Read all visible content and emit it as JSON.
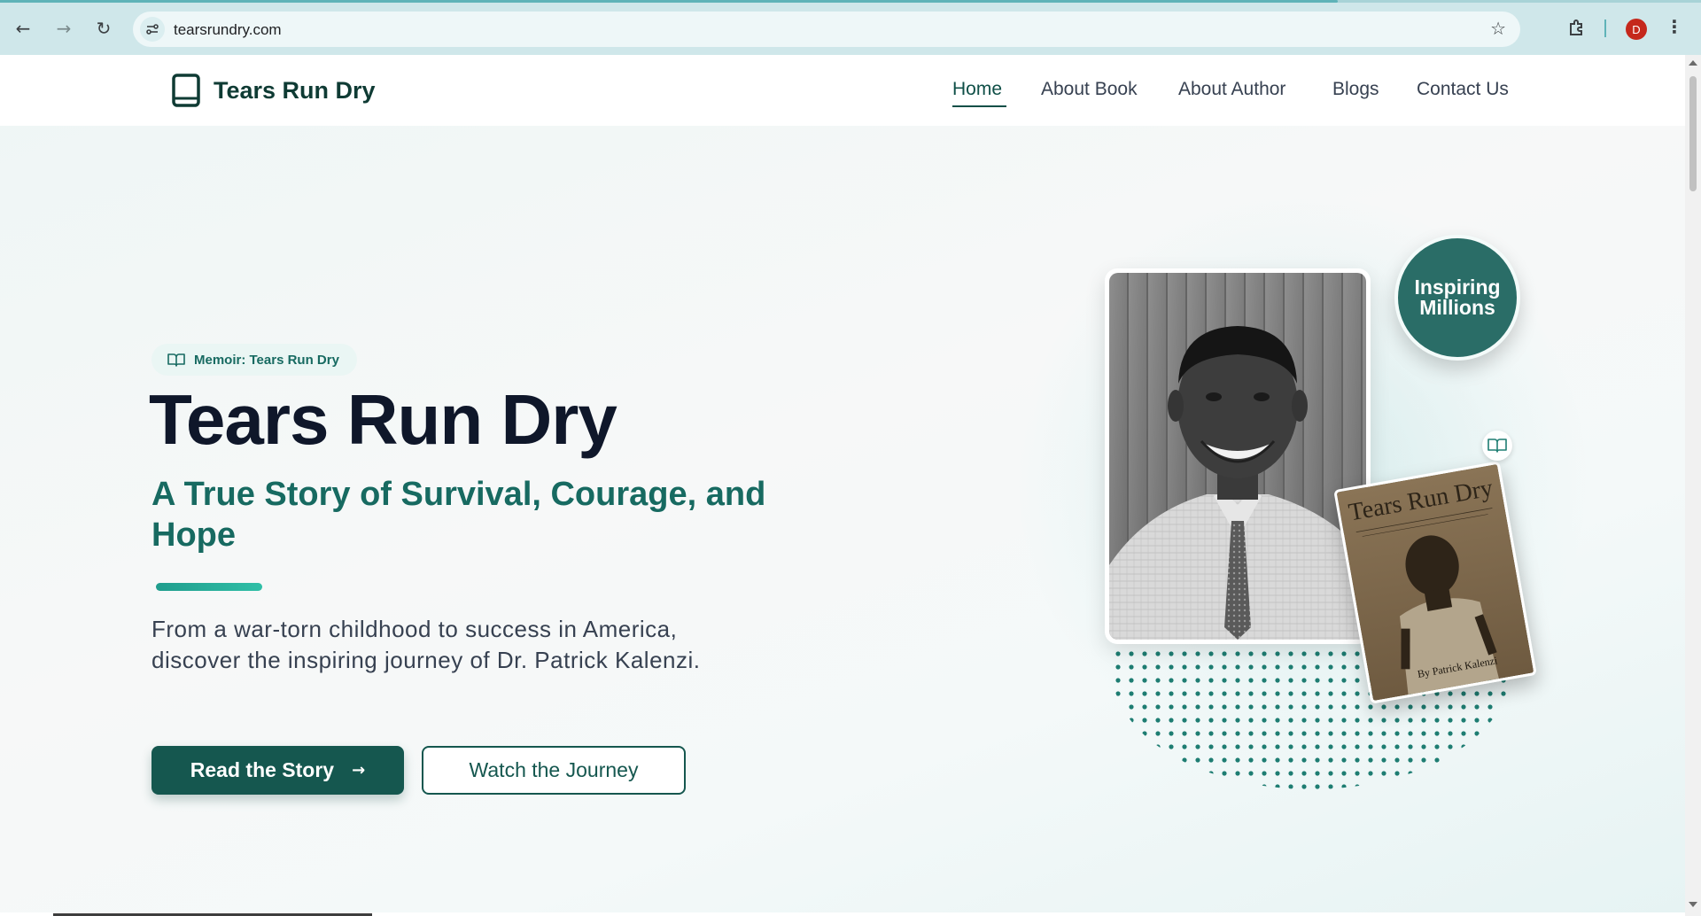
{
  "browser": {
    "url": "tearsrundry.com",
    "profile_initial": "D",
    "icons": [
      "back-icon",
      "forward-icon",
      "reload-icon",
      "site-info-icon",
      "bookmark-star-icon",
      "extensions-icon",
      "menu-icon"
    ]
  },
  "header": {
    "brand": "Tears Run Dry",
    "nav": [
      {
        "label": "Home",
        "active": true
      },
      {
        "label": "About Book"
      },
      {
        "label": "About Author"
      },
      {
        "label": "Blogs"
      },
      {
        "label": "Contact Us"
      }
    ]
  },
  "hero": {
    "badge": "Memoir: Tears Run Dry",
    "title": "Tears Run Dry",
    "subtitle": "A True Story of Survival, Courage, and Hope",
    "description": "From a war-torn childhood to success in America, discover the inspiring journey of Dr. Patrick Kalenzi.",
    "primary_button": "Read the Story",
    "secondary_button": "Watch the Journey",
    "circle_badge_line1": "Inspiring",
    "circle_badge_line2": "Millions"
  },
  "book_cover": {
    "title": "Tears Run Dry",
    "author": "By Patrick Kalenzi"
  },
  "colors": {
    "brand_dark": "#15574f",
    "brand_text": "#176a61",
    "accent": "#2fbfa7",
    "heading": "#0f172a"
  }
}
